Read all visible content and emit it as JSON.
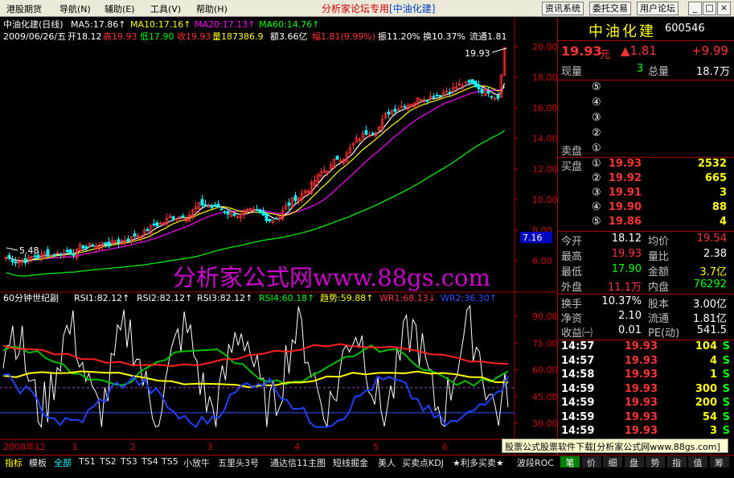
{
  "menu": {
    "items": [
      "港股期货",
      "导航(N)",
      "辅助(E)",
      "工具(V)",
      "帮助(H)"
    ],
    "center_title": "分析家论坛专用",
    "center_stock": "[中油化建]",
    "right_buttons": [
      "资讯系统",
      "委托交易",
      "用户论坛"
    ],
    "window_buttons": [
      "_",
      "□",
      "×"
    ]
  },
  "main_chart": {
    "header1": {
      "name": "中油化建(日线)",
      "ma5": "MA5:17.86↑",
      "ma10": "MA10:17.16↑",
      "ma20": "MA20:17.13↑",
      "ma60": "MA60:14.76↑"
    },
    "header2": {
      "date": "2009/06/26/五",
      "open": "开18.12",
      "high": "高19.93",
      "low": "低17.90",
      "close": "收19.93",
      "volume": "量187386.9",
      "amount": "额3.66亿",
      "range": "幅1.81(9.99%)",
      "amplitude": "振11.20%",
      "turnover": "换10.37%",
      "float": "流通1.81"
    },
    "price_ticks": [
      "20.00",
      "18.00",
      "16.00",
      "14.00",
      "12.00",
      "10.00",
      "8.00",
      "6.00"
    ],
    "high_label": "19.93",
    "low_label": "5.48",
    "cursor_price": "7.16",
    "colors": {
      "ma5": "#ffffff",
      "ma10": "#ffff00",
      "ma20": "#ff00ff",
      "ma60": "#00ff00",
      "up": "#ff3333",
      "down": "#00ffff"
    }
  },
  "sub_chart": {
    "name": "60分钟世纪副",
    "rsi1": "RSI1:82.12↑",
    "rsi2": "RSI2:82.12↑",
    "rsi3": "RSI3:82.12↑",
    "rsi4": "RSI4:60.18↑",
    "trend": "趋势:59.88↑",
    "wr1": "WR1:68.13↓",
    "wr2": "WR2:36.30↑",
    "ticks": [
      "90.00",
      "75.00",
      "60.00",
      "45.00",
      "30.00"
    ]
  },
  "time_axis": {
    "year_label": "2008年12",
    "months": [
      "1",
      "2",
      "3",
      "4",
      "5",
      "6"
    ]
  },
  "watermark": "分析家公式网www.88gs.com",
  "quote": {
    "name": "中油化建",
    "code": "600546",
    "price": "19.93",
    "price_unit": "元",
    "change": "▲1.81",
    "pct": "+9.99",
    "xianliang_label": "现量",
    "xianliang": "3",
    "zongliang_label": "总量",
    "zongliang": "18.7万",
    "sell_label": "卖盘",
    "buy_label": "买盘",
    "sell_levels": [
      "⑤",
      "④",
      "③",
      "②",
      "①"
    ],
    "buy_levels": [
      {
        "lvl": "①",
        "price": "19.93",
        "vol": "2532"
      },
      {
        "lvl": "②",
        "price": "19.92",
        "vol": "665"
      },
      {
        "lvl": "③",
        "price": "19.91",
        "vol": "3"
      },
      {
        "lvl": "④",
        "price": "19.90",
        "vol": "88"
      },
      {
        "lvl": "⑤",
        "price": "19.86",
        "vol": "4"
      }
    ],
    "stats": [
      {
        "l1": "今开",
        "v1": "18.12",
        "l2": "均价",
        "v2": "19.54"
      },
      {
        "l1": "最高",
        "v1": "19.93",
        "l2": "量比",
        "v2": "2.38"
      },
      {
        "l1": "最低",
        "v1": "17.90",
        "l2": "金额",
        "v2": "3.7亿"
      },
      {
        "l1": "外盘",
        "v1": "11.1万",
        "l2": "内盘",
        "v2": "76292"
      }
    ],
    "stats2": [
      {
        "l1": "换手",
        "v1": "10.37%",
        "l2": "股本",
        "v2": "3.00亿"
      },
      {
        "l1": "净资",
        "v1": "2.10",
        "l2": "流通",
        "v2": "1.81亿"
      },
      {
        "l1": "收益㈠",
        "v1": "0.01",
        "l2": "PE(动)",
        "v2": "541.5"
      }
    ],
    "ticks": [
      {
        "time": "14:57",
        "price": "19.93",
        "vol": "104",
        "side": "S"
      },
      {
        "time": "14:57",
        "price": "19.93",
        "vol": "4",
        "side": "S"
      },
      {
        "time": "14:58",
        "price": "19.93",
        "vol": "1",
        "side": "S"
      },
      {
        "time": "14:59",
        "price": "19.93",
        "vol": "300",
        "side": "S"
      },
      {
        "time": "14:59",
        "price": "19.93",
        "vol": "200",
        "side": "S"
      },
      {
        "time": "14:59",
        "price": "19.93",
        "vol": "54",
        "side": "S"
      },
      {
        "time": "14:59",
        "price": "19.93",
        "vol": "3",
        "side": "S"
      }
    ]
  },
  "ad_bar": "股票公式股票软件下载[分析家公式网www.88gs.com]",
  "bottom_tabs": [
    "指标",
    "模板",
    "全部",
    "TS1",
    "TS2",
    "TS3",
    "TS4",
    "TS5",
    "小放牛",
    "五里头3号",
    "通达信11主图",
    "短线掘金",
    "美人",
    "买卖点KDJ",
    "★利多买卖★",
    "波段ROC"
  ],
  "right_tabs": [
    "笔",
    "价",
    "细",
    "盘",
    "势",
    "指",
    "值",
    "筹"
  ]
}
